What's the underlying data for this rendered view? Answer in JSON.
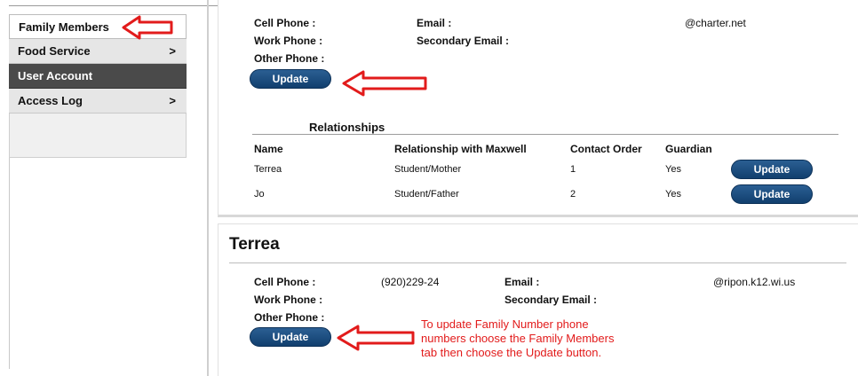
{
  "sidebar": {
    "items": [
      {
        "label": "Family Members",
        "chevron": ""
      },
      {
        "label": "Food Service",
        "chevron": ">"
      },
      {
        "label": "User Account",
        "chevron": ""
      },
      {
        "label": "Access Log",
        "chevron": ">"
      }
    ]
  },
  "contact1": {
    "cell_label": "Cell Phone :",
    "work_label": "Work Phone :",
    "other_label": "Other Phone :",
    "email_label": "Email :",
    "secondary_email_label": "Secondary Email :",
    "email_value": "@charter.net",
    "update_label": "Update"
  },
  "relationships": {
    "title": "Relationships",
    "headers": [
      "Name",
      "Relationship with Maxwell",
      "Contact Order",
      "Guardian"
    ],
    "rows": [
      {
        "name": "Terrea",
        "relationship": "Student/Mother",
        "order": "1",
        "guardian": "Yes",
        "button": "Update"
      },
      {
        "name": "Jo",
        "relationship": "Student/Father",
        "order": "2",
        "guardian": "Yes",
        "button": "Update"
      }
    ]
  },
  "contact2": {
    "name": "Terrea",
    "cell_label": "Cell Phone :",
    "cell_value": "(920)229-24",
    "work_label": "Work Phone :",
    "other_label": "Other Phone :",
    "email_label": "Email :",
    "secondary_email_label": "Secondary Email :",
    "email_value": "@ripon.k12.wi.us",
    "update_label": "Update"
  },
  "annotation": {
    "note": "To update Family Number phone numbers choose the Family Members tab then choose the Update button.",
    "arrow_color": "#e21b1b"
  }
}
